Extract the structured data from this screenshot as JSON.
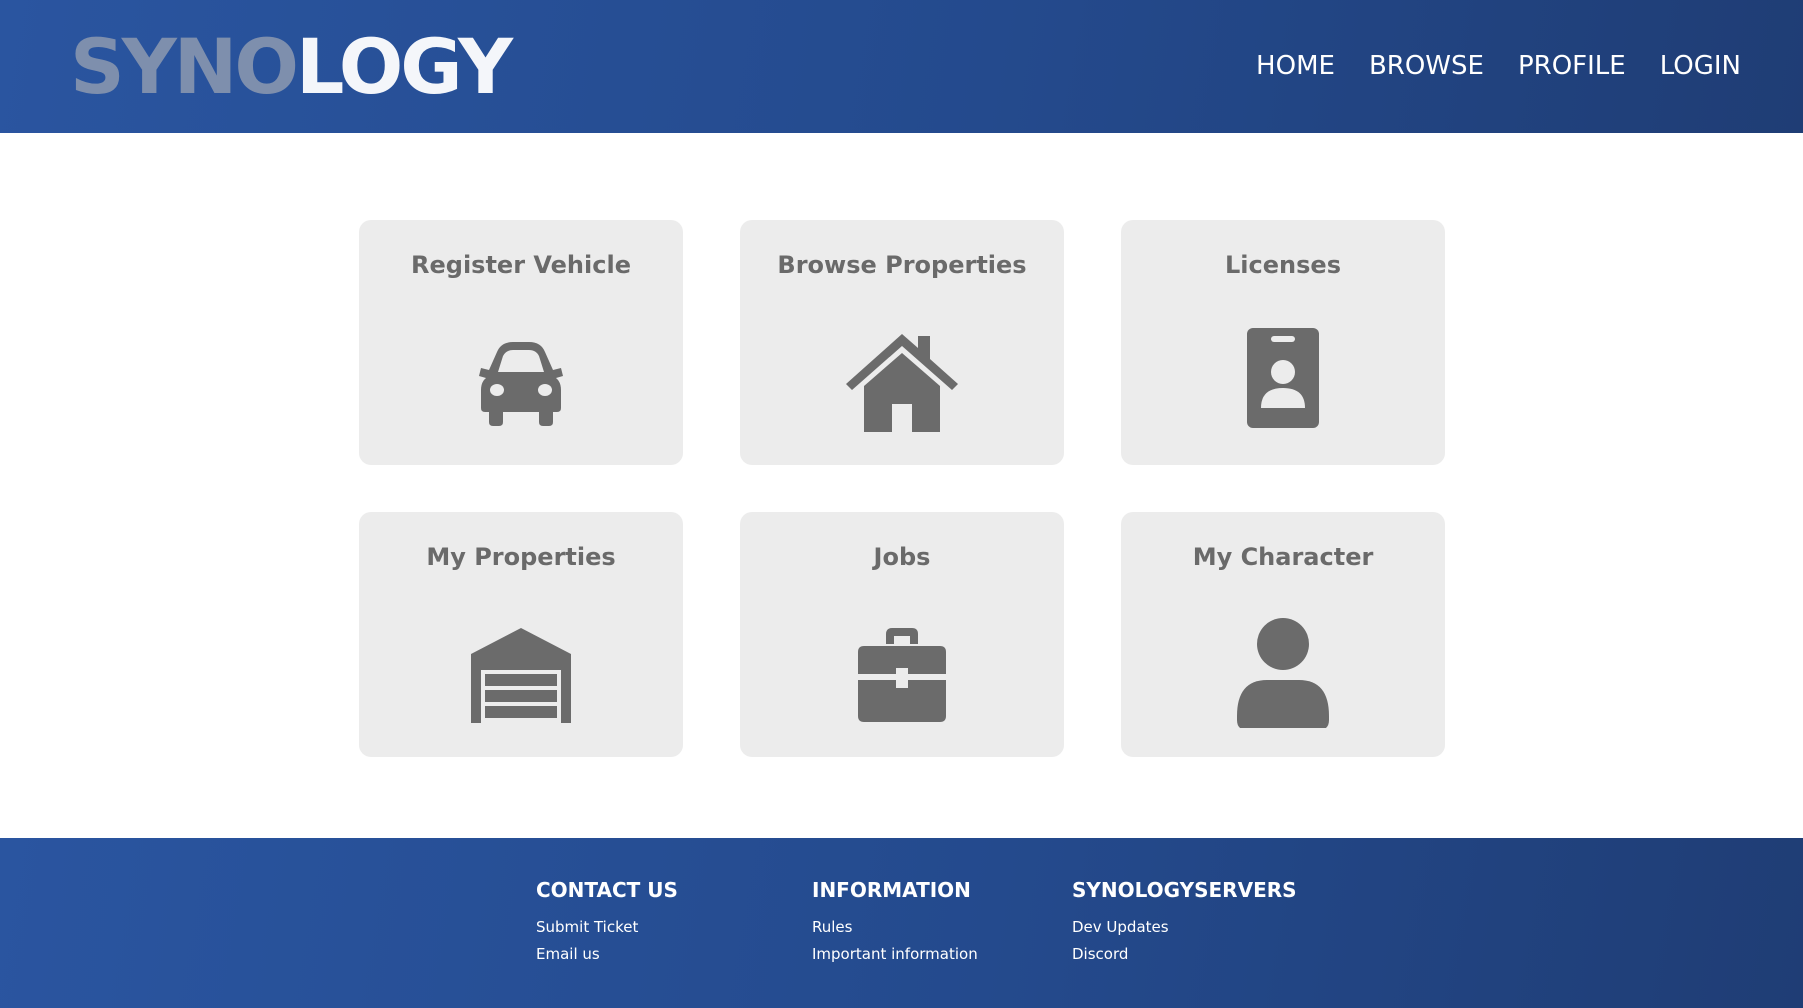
{
  "header": {
    "logo_part1": "SYNO",
    "logo_part2": "LOGY",
    "nav": [
      "HOME",
      "BROWSE",
      "PROFILE",
      "LOGIN"
    ]
  },
  "cards": [
    {
      "title": "Register Vehicle",
      "icon": "car-icon"
    },
    {
      "title": "Browse Properties",
      "icon": "house-icon"
    },
    {
      "title": "Licenses",
      "icon": "id-badge-icon"
    },
    {
      "title": "My Properties",
      "icon": "garage-icon"
    },
    {
      "title": "Jobs",
      "icon": "briefcase-icon"
    },
    {
      "title": "My Character",
      "icon": "user-icon"
    }
  ],
  "footer": {
    "columns": [
      {
        "heading": "CONTACT US",
        "links": [
          "Submit Ticket",
          "Email us"
        ]
      },
      {
        "heading": "INFORMATION",
        "links": [
          "Rules",
          "Important information"
        ]
      },
      {
        "heading": "SYNOLOGYSERVERS",
        "links": [
          "Dev Updates",
          "Discord"
        ]
      }
    ]
  },
  "colors": {
    "brand_blue": "#2a55a0",
    "card_bg": "#ececec",
    "icon_gray": "#6b6b6b",
    "logo_dim": "#7e8fad"
  }
}
